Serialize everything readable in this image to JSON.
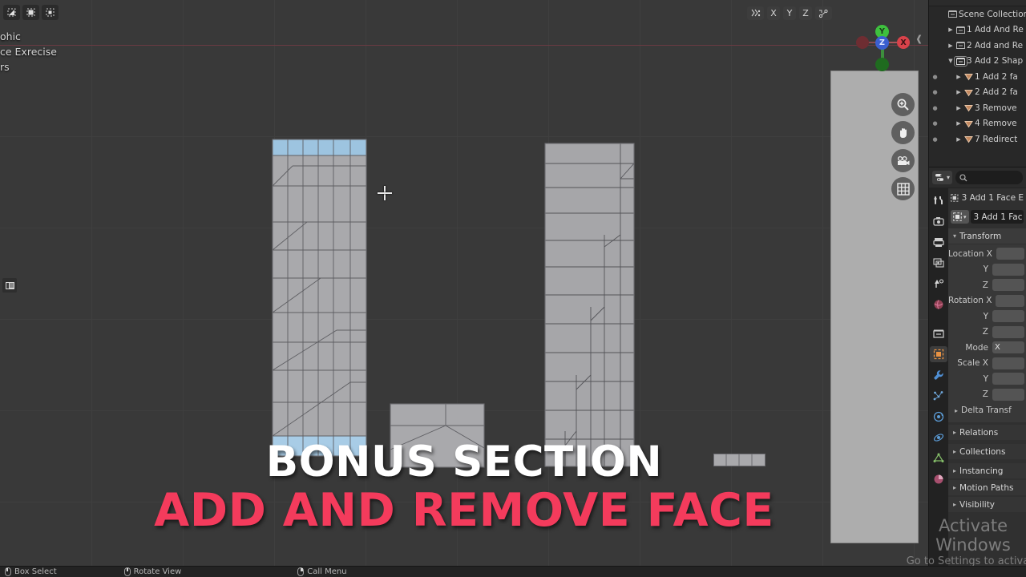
{
  "app": {
    "name": "Blender",
    "theme_bg": "#393939",
    "accent": "#4772b3"
  },
  "viewport": {
    "select_modes": [
      {
        "name": "vertex-select-mode",
        "active": false
      },
      {
        "name": "edge-select-mode",
        "active": false
      },
      {
        "name": "face-select-mode",
        "active": true
      }
    ],
    "overlay_text": [
      "ohic",
      "ce Exrecise",
      "rs"
    ],
    "axis_buttons": [
      "X",
      "Y",
      "Z"
    ],
    "gizmo": {
      "y_label": "Y",
      "y_color": "#3ec03e",
      "z_label": "Z",
      "z_color": "#3b5fd0",
      "x_label": "X",
      "x_color": "#d9424a",
      "neg_x_color": "#6e2d32",
      "neg_y_color": "#1f6b1f"
    },
    "nav_buttons": [
      "zoom-icon",
      "pan-hand-icon",
      "camera-icon",
      "grid-icon"
    ],
    "left_panel_icon": "toolbar-icon",
    "cursor": "crosshair-cursor"
  },
  "title_overlay": {
    "line1": "BONUS SECTION",
    "line2": "ADD AND REMOVE FACE",
    "line1_color": "#ffffff",
    "line2_color": "#f43b5c"
  },
  "outliner": {
    "root": {
      "label": "Scene Collection",
      "icon": "collection-icon"
    },
    "rows": [
      {
        "label": "1 Add And Re",
        "icon": "collection-icon",
        "twisty": "▶",
        "indent": 1,
        "dot": false,
        "active": false
      },
      {
        "label": "2 Add and Re",
        "icon": "collection-icon",
        "twisty": "▶",
        "indent": 1,
        "dot": false,
        "active": false
      },
      {
        "label": "3 Add 2 Shap",
        "icon": "collection-icon",
        "twisty": "▼",
        "indent": 1,
        "dot": false,
        "active": true
      },
      {
        "label": "1 Add 2 fa",
        "icon": "mesh-icon",
        "twisty": "▶",
        "indent": 2,
        "dot": true,
        "active": false
      },
      {
        "label": "2 Add 2 fa",
        "icon": "mesh-icon",
        "twisty": "▶",
        "indent": 2,
        "dot": true,
        "active": false
      },
      {
        "label": "3 Remove",
        "icon": "mesh-icon",
        "twisty": "▶",
        "indent": 2,
        "dot": true,
        "active": false
      },
      {
        "label": "4 Remove",
        "icon": "mesh-icon",
        "twisty": "▶",
        "indent": 2,
        "dot": true,
        "active": false
      },
      {
        "label": "7 Redirect",
        "icon": "mesh-icon",
        "twisty": "▶",
        "indent": 2,
        "dot": true,
        "active": false
      }
    ]
  },
  "properties": {
    "editor_type": "properties-editor-icon",
    "search_placeholder": "",
    "tabs": [
      {
        "name": "tool-tab",
        "active": false
      },
      {
        "name": "render-tab",
        "active": false
      },
      {
        "name": "output-tab",
        "active": false
      },
      {
        "name": "view-layer-tab",
        "active": false
      },
      {
        "name": "scene-tab",
        "active": false
      },
      {
        "name": "world-tab",
        "active": false
      },
      {
        "name": "collection-tab",
        "active": false
      },
      {
        "name": "object-tab",
        "active": true
      },
      {
        "name": "modifier-tab",
        "active": false
      },
      {
        "name": "particles-tab",
        "active": false
      },
      {
        "name": "physics-tab",
        "active": false
      },
      {
        "name": "constraints-tab",
        "active": false
      },
      {
        "name": "object-data-tab",
        "active": false
      },
      {
        "name": "material-tab",
        "active": false
      }
    ],
    "breadcrumb": "3 Add 1 Face E",
    "id_field": "3 Add 1 Fac",
    "transform": {
      "title": "Transform",
      "fields": [
        {
          "label": "Location X",
          "value": ""
        },
        {
          "label": "Y",
          "value": ""
        },
        {
          "label": "Z",
          "value": ""
        },
        {
          "label": "Rotation X",
          "value": ""
        },
        {
          "label": "Y",
          "value": ""
        },
        {
          "label": "Z",
          "value": ""
        },
        {
          "label": "Mode",
          "value": "X"
        },
        {
          "label": "Scale X",
          "value": ""
        },
        {
          "label": "Y",
          "value": ""
        },
        {
          "label": "Z",
          "value": ""
        }
      ],
      "subpanel": "Delta Transf"
    },
    "panels": [
      "Relations",
      "Collections",
      "Instancing",
      "Motion Paths",
      "Visibility"
    ]
  },
  "statusbar": {
    "items": [
      {
        "label": "Box Select",
        "mouse": "left"
      },
      {
        "label": "Rotate View",
        "mouse": "middle"
      },
      {
        "label": "Call Menu",
        "mouse": "right"
      }
    ]
  },
  "watermark": {
    "line1": "Activate Windows",
    "line2": "Go to Settings to activate Windows."
  }
}
